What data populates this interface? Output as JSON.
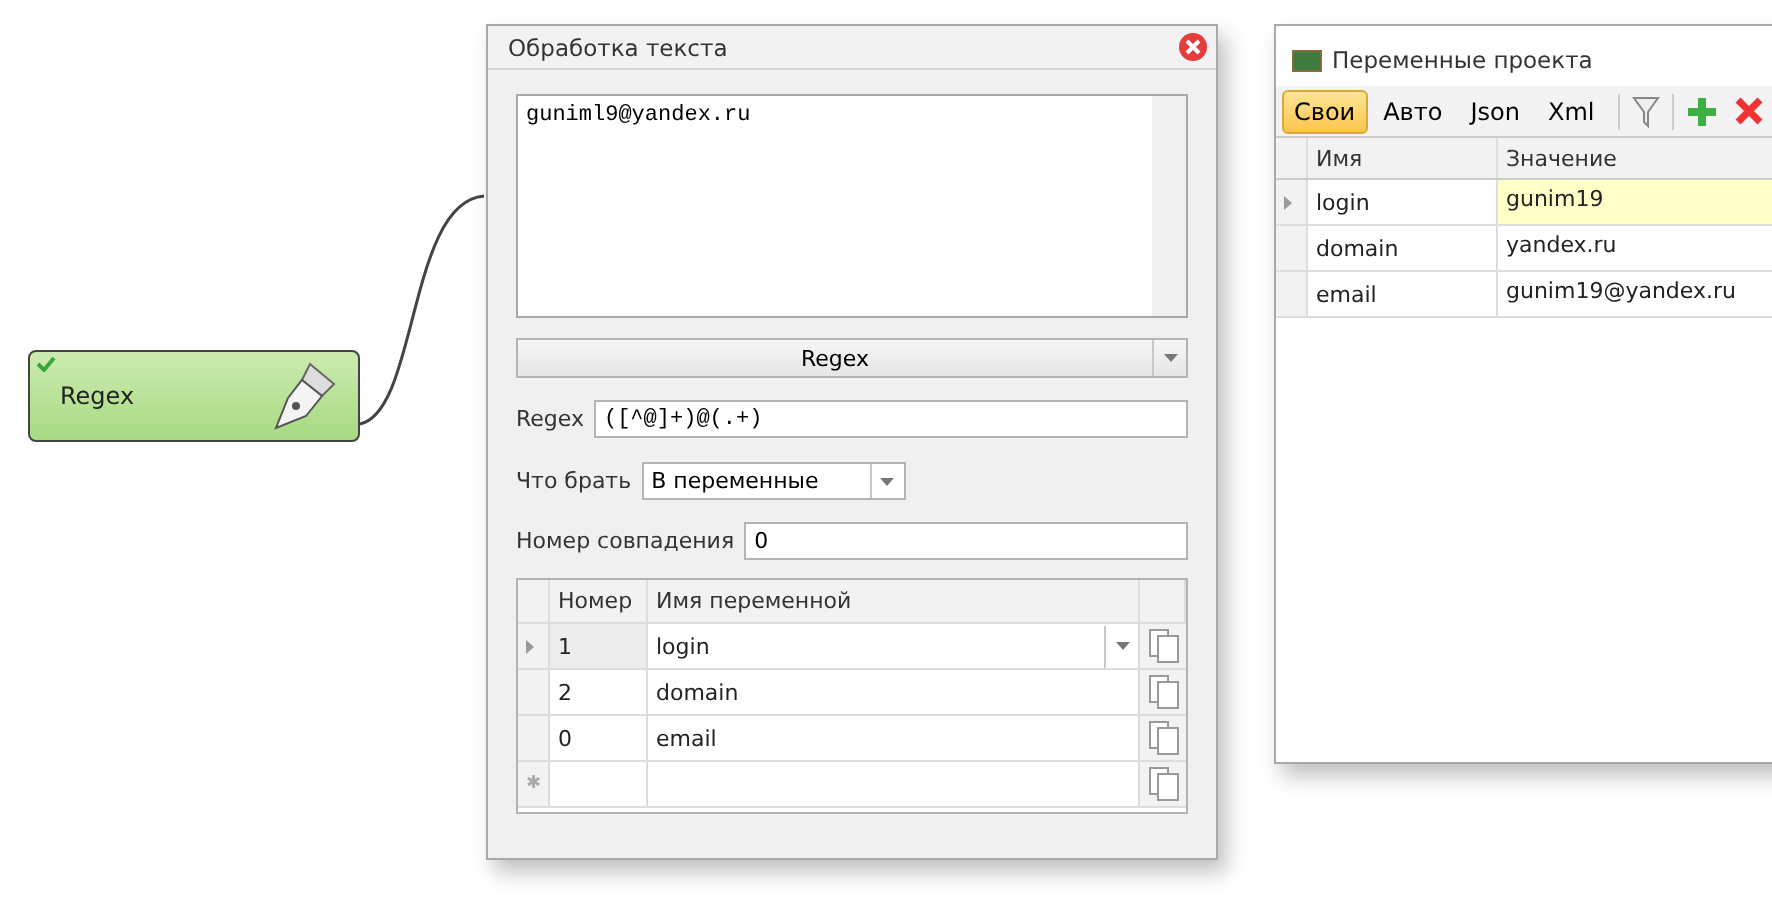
{
  "node": {
    "title": "Regex",
    "ok": true
  },
  "dialog": {
    "title": "Обработка текста",
    "input_text": "guniml9@yandex.ru",
    "mode": "Regex",
    "regex_label": "Regex",
    "regex": "([^@]+)@(.+)",
    "take_label": "Что брать",
    "take": "В переменные",
    "match_label": "Номер совпадения",
    "match": "0",
    "columns": [
      "Номер",
      "Имя переменной"
    ],
    "rows": [
      {
        "number": "1",
        "name": "login",
        "selected": true
      },
      {
        "number": "2",
        "name": "domain",
        "selected": false
      },
      {
        "number": "0",
        "name": "email",
        "selected": false
      }
    ],
    "new_row_mark": "✱"
  },
  "variables": {
    "title": "Переменные проекта",
    "tabs": [
      {
        "label": "Свои",
        "selected": true
      },
      {
        "label": "Авто",
        "selected": false
      },
      {
        "label": "Json",
        "selected": false
      },
      {
        "label": "Xml",
        "selected": false
      }
    ],
    "columns": [
      "Имя",
      "Значение"
    ],
    "rows": [
      {
        "name": "login",
        "value": "gunim19",
        "selected": true
      },
      {
        "name": "domain",
        "value": "yandex.ru",
        "selected": false
      },
      {
        "name": "email",
        "value": "gunim19@yandex.ru",
        "selected": false
      }
    ]
  }
}
